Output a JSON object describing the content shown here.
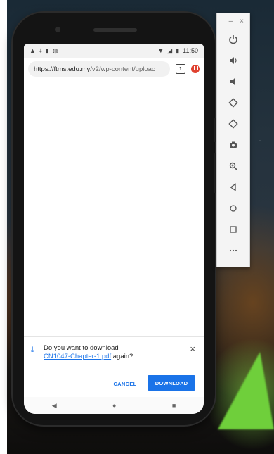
{
  "phone": {
    "status_bar": {
      "left_icons": [
        "alert-icon",
        "download-icon",
        "sd-icon",
        "shield-icon"
      ],
      "right_icons": [
        "wifi-icon",
        "signal-icon",
        "battery-icon"
      ],
      "time": "11:50"
    },
    "browser": {
      "url_host": "https://ftms.edu.my",
      "url_path": "/v2/wp-content/uploac",
      "tab_count": "1"
    },
    "download_prompt": {
      "question": "Do you want to download",
      "filename": "CN1047-Chapter-1.pdf",
      "suffix": " again?",
      "cancel_label": "CANCEL",
      "download_label": "DOWNLOAD",
      "accent_color": "#1a73e8"
    },
    "nav_bar": {
      "back": "◀",
      "home": "●",
      "recents": "■"
    }
  },
  "emulator_toolbar": {
    "minimize": "–",
    "close": "×",
    "buttons": [
      "power-icon",
      "volume-up-icon",
      "volume-down-icon",
      "rotate-left-icon",
      "rotate-right-icon",
      "camera-icon",
      "zoom-icon",
      "back-icon",
      "home-icon",
      "overview-icon",
      "more-icon"
    ]
  }
}
